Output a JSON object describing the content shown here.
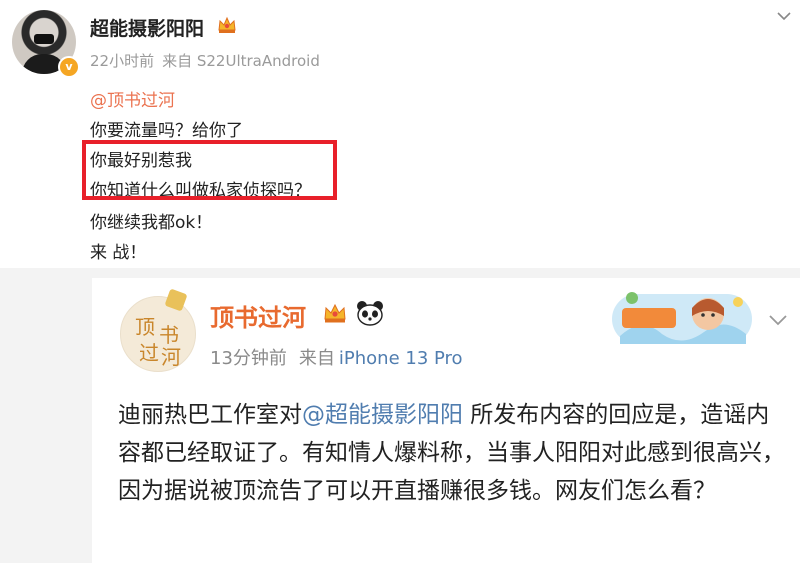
{
  "post": {
    "username": "超能摄影阳阳",
    "time": "22小时前",
    "source": "来自 S22UltraAndroid",
    "verified_badge": "v",
    "mention": "@顶书过河",
    "lines": [
      "你要流量吗？给你了",
      "你最好别惹我",
      "你知道什么叫做私家侦探吗？",
      "你继续我都ok！",
      "来 战！"
    ],
    "highlight_color": "#e8202a"
  },
  "quoted": {
    "username": "顶书过河",
    "avatar_text": [
      "顶",
      "书",
      "过",
      "河"
    ],
    "time": "13分钟前",
    "source_prefix": "来自",
    "device": "iPhone 13 Pro",
    "text_before": "迪丽热巴工作室对",
    "mention": "@超能摄影阳阳",
    "text_after": " 所发布内容的回应是，造谣内容都已经取证了。有知情人爆料称，当事人阳阳对此感到很高兴，因为据说被顶流告了可以开直播赚很多钱。网友们怎么看？"
  },
  "icons": {
    "more_menu": "chevron-down-icon",
    "crown": "crown-icon",
    "panda": "panda-icon"
  },
  "colors": {
    "mention_orange": "#eb7350",
    "link_blue": "#507daf",
    "name_orange": "#e86a2f"
  }
}
